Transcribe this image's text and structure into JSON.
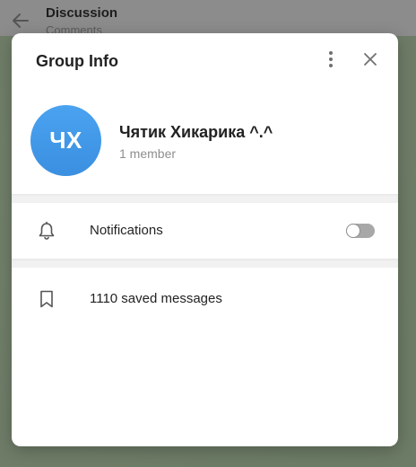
{
  "background": {
    "title": "Discussion",
    "subtitle": "Comments"
  },
  "dialog": {
    "title": "Group Info",
    "group": {
      "avatar_initials": "ЧХ",
      "name": "Чятик Хикарика ^.^",
      "members": "1 member"
    },
    "notifications": {
      "label": "Notifications",
      "enabled": false
    },
    "saved": {
      "label": "1110 saved messages"
    }
  },
  "colors": {
    "avatar": "#3b8fe0",
    "toggle_off": "#a8a8a8"
  },
  "icons": [
    "back-arrow-icon",
    "more-vertical-icon",
    "close-icon",
    "bell-icon",
    "bookmark-icon"
  ]
}
